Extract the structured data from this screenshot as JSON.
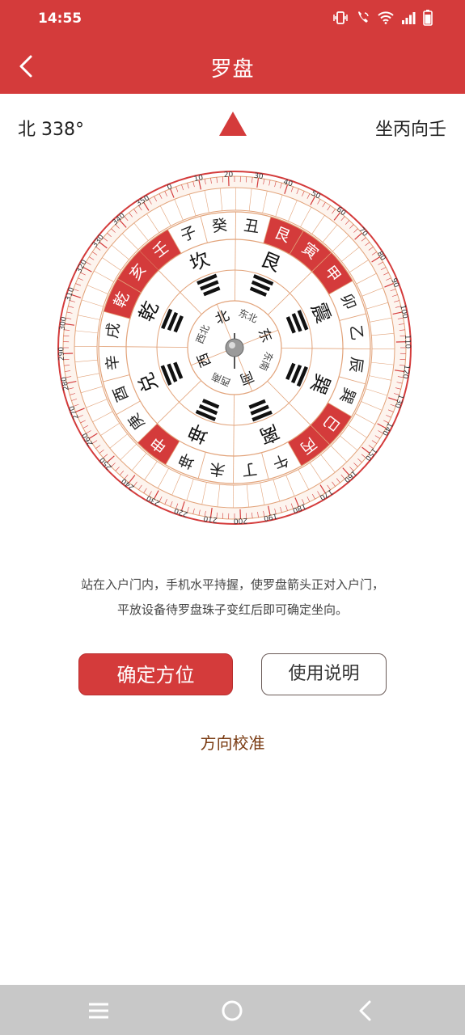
{
  "status_bar": {
    "time": "14:55",
    "icons": [
      "vibrate-icon",
      "wifi-call-icon",
      "wifi-icon",
      "signal-icon",
      "battery-icon"
    ]
  },
  "app_bar": {
    "title": "罗盘",
    "back_icon": "chevron-left-icon"
  },
  "heading": {
    "direction": "北 338°",
    "facing": "坐丙向壬"
  },
  "compass": {
    "inner_ring": [
      "北",
      "东北",
      "东",
      "东南",
      "南",
      "西南",
      "西",
      "西北"
    ],
    "trigram_ring": [
      "坎",
      "艮",
      "震",
      "巽",
      "离",
      "坤",
      "兑",
      "乾"
    ],
    "mountains": [
      "壬",
      "子",
      "癸",
      "丑",
      "艮",
      "寅",
      "甲",
      "卯",
      "乙",
      "辰",
      "巽",
      "巳",
      "丙",
      "午",
      "丁",
      "未",
      "坤",
      "申",
      "庚",
      "酉",
      "辛",
      "戌",
      "乾",
      "亥"
    ],
    "degree_labels": [
      "0",
      "10",
      "20",
      "30",
      "40",
      "50",
      "60",
      "70",
      "80",
      "90",
      "100",
      "110",
      "120",
      "130",
      "140",
      "150",
      "160",
      "170",
      "180",
      "190",
      "200",
      "210",
      "220",
      "230",
      "240",
      "250",
      "260",
      "270",
      "280",
      "290",
      "300",
      "310",
      "320",
      "330",
      "340",
      "350"
    ]
  },
  "instructions": {
    "line1": "站在入户门内，手机水平持握，使罗盘箭头正对入户门，",
    "line2": "平放设备待罗盘珠子变红后即可确定坐向。"
  },
  "buttons": {
    "confirm": "确定方位",
    "help": "使用说明"
  },
  "calibrate": "方向校准",
  "colors": {
    "primary": "#d43b3b",
    "accent_brown": "#7a3b12",
    "compass_line": "#e2a37a"
  },
  "nav_bar": {
    "icons": [
      "menu-icon",
      "home-circle-icon",
      "back-icon"
    ]
  }
}
